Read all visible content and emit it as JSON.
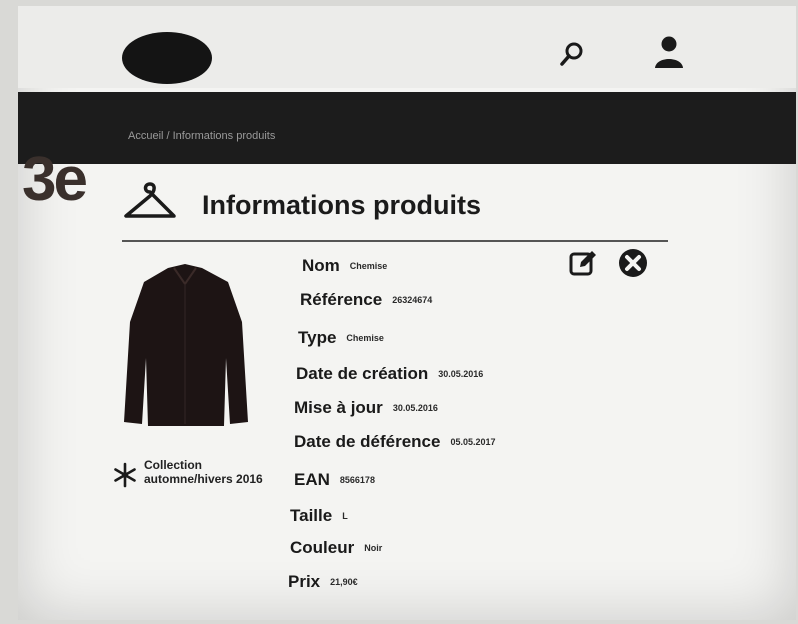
{
  "header": {
    "logo_icon": "logo-badge",
    "search_icon": "search-icon",
    "user_icon": "user-icon"
  },
  "breadcrumb": "Accueil / Informations produits",
  "watermark": "3e",
  "page": {
    "title": "Informations produits",
    "title_icon": "hanger-icon",
    "actions": {
      "edit_icon": "edit-icon",
      "close_icon": "close-circle-icon"
    }
  },
  "product": {
    "image": "shirt",
    "collection": {
      "icon": "snowflake-icon",
      "label": "Collection automne/hivers 2016"
    },
    "fields": [
      {
        "label": "Nom",
        "value": "Chemise"
      },
      {
        "label": "Référence",
        "value": "26324674"
      },
      {
        "label": "Type",
        "value": "Chemise"
      },
      {
        "label": "Date de création",
        "value": "30.05.2016"
      },
      {
        "label": "Mise à jour",
        "value": "30.05.2016"
      },
      {
        "label": "Date de déférence",
        "value": "05.05.2017"
      },
      {
        "label": "EAN",
        "value": "8566178"
      },
      {
        "label": "Taille",
        "value": "L"
      },
      {
        "label": "Couleur",
        "value": "Noir"
      },
      {
        "label": "Prix",
        "value": "21,90€"
      }
    ]
  },
  "colors": {
    "header_dark": "#1c1c1c",
    "text": "#1b1b1b",
    "background": "#f4f4f2"
  }
}
